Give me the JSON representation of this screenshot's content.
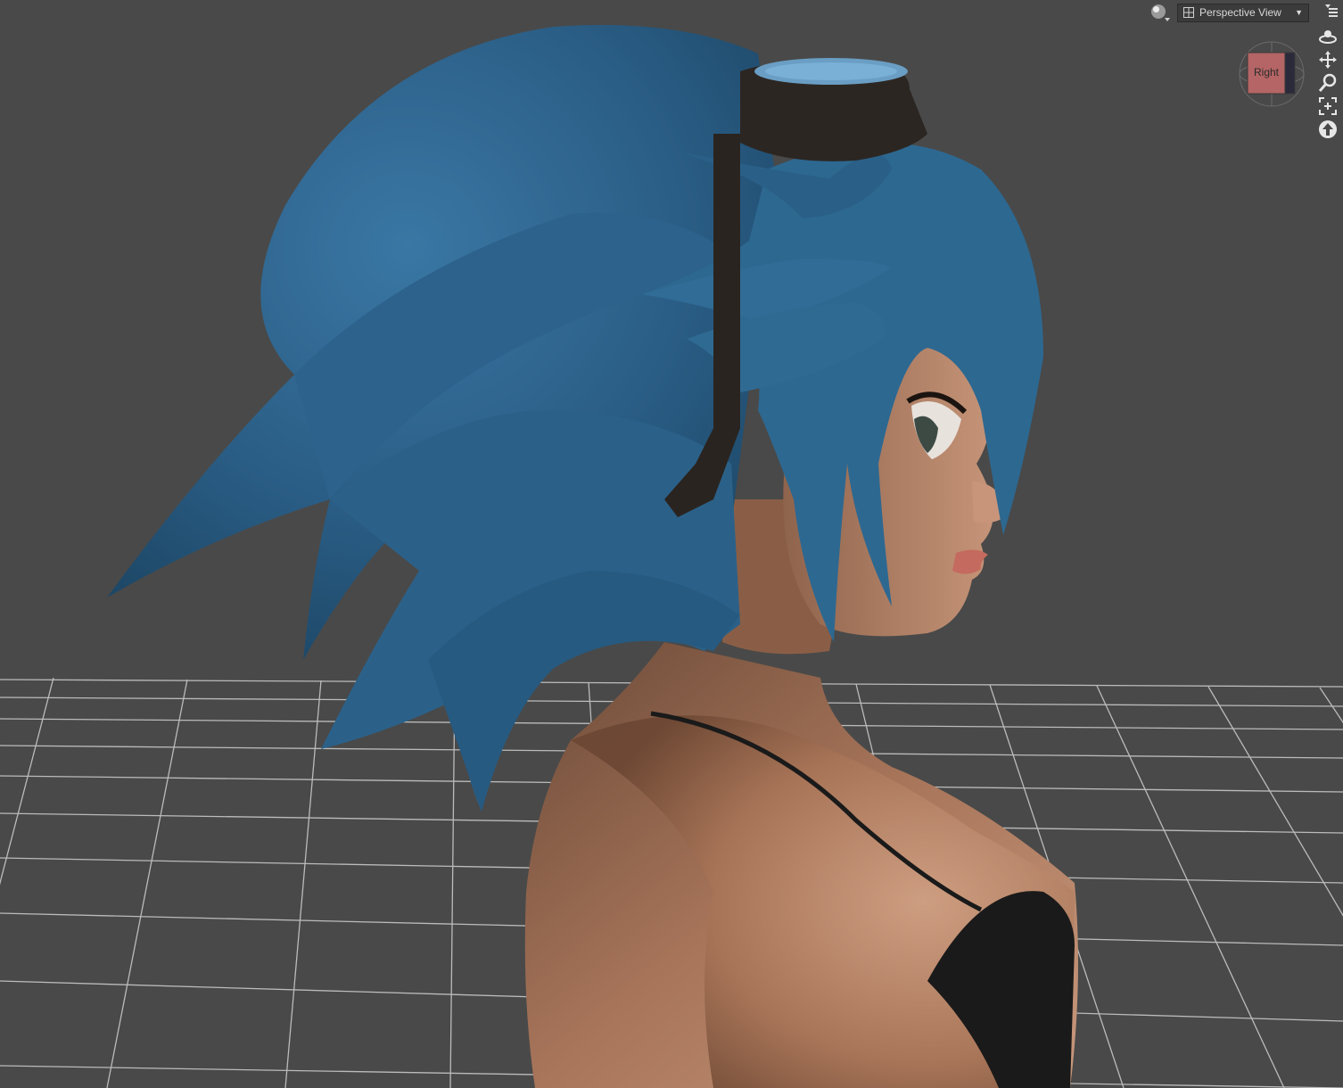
{
  "viewport": {
    "view_label": "Perspective View",
    "cube_face": "Right",
    "icons": {
      "render_mode": "sphere-shading-icon",
      "view_grid": "grid-layout-icon",
      "dropdown": "chevron-down-icon",
      "menu": "panel-menu-icon",
      "orbit": "orbit-icon",
      "pan": "pan-move-icon",
      "zoom": "zoom-magnifier-icon",
      "frame": "frame-selection-icon",
      "reset": "reset-view-icon"
    },
    "colors": {
      "background": "#494949",
      "grid": "#cfcfcf",
      "hair": "#2f6690",
      "skin": "#b98464",
      "top": "#1a1a1a",
      "cube_face": "#b56565"
    }
  }
}
